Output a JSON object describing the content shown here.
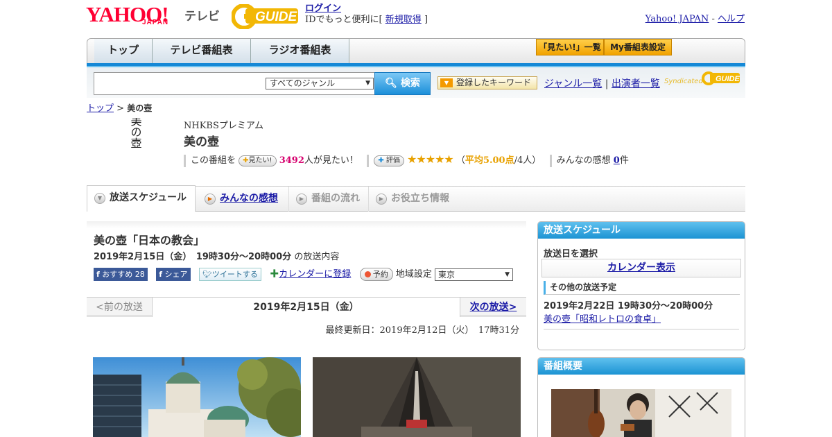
{
  "header": {
    "logo_yahoo": "YAHOO!",
    "logo_japan": "JAPAN",
    "logo_tv": "テレビ",
    "logo_gguide": "GUIDE",
    "login": "ログイン",
    "login_sub_prefix": "IDでもっと便利に[",
    "signup": "新規取得",
    "login_sub_suffix": "]",
    "yahoo_japan_link": "Yahoo! JAPAN",
    "sep": "-",
    "help_link": "ヘルプ"
  },
  "nav": {
    "tabs": [
      "トップ",
      "テレビ番組表",
      "ラジオ番組表"
    ],
    "watchlist_btn": "「見たい!」一覧",
    "my_schedule_btn": "My番組表設定"
  },
  "search": {
    "input_value": "",
    "genre_selected": "すべてのジャンル",
    "search_btn": "検索",
    "keyword_btn": "登録したキーワード",
    "genre_list": "ジャンル一覧",
    "divider": "|",
    "performer_list": "出演者一覧",
    "syndicated": "Syndicated",
    "gguide_small": "GUIDE"
  },
  "breadcrumb": {
    "top": "トップ",
    "sep": ">",
    "current": "美の壺"
  },
  "program": {
    "thumb_text": "美の壺",
    "channel": "NHKBSプレミアム",
    "title": "美の壺",
    "want_prefix": "この番組を",
    "want_btn": "見たい!",
    "want_count": "3492",
    "want_suffix": "人が見たい！",
    "rate_btn": "評価",
    "stars": "★★★★★",
    "avg_open": "（",
    "avg_label": "平均5.00点",
    "avg_count": "/4人）",
    "impressions_label": "みんなの感想",
    "impressions_count": "0",
    "impressions_unit": "件"
  },
  "tabs": [
    {
      "label": "放送スケジュール",
      "state": "active"
    },
    {
      "label": "みんなの感想",
      "state": "link"
    },
    {
      "label": "番組の流れ",
      "state": "disabled"
    },
    {
      "label": "お役立ち情報",
      "state": "disabled"
    }
  ],
  "episode": {
    "title": "美の壺「日本の教会」",
    "date": "2019年2月15日（金）　19時30分～20時00分",
    "date_suffix": "の放送内容",
    "fb_recommend": "おすすめ",
    "fb_count": "28",
    "fb_share": "シェア",
    "tweet": "ツイートする",
    "calendar": "カレンダーに登録",
    "reserve": "予約",
    "region_label": "地域設定",
    "region_value": "東京"
  },
  "pager": {
    "prev": "<前の放送",
    "current": "2019年2月15日（金）",
    "next": "次の放送>"
  },
  "updated": "最終更新日：2019年2月12日（火）　17時31分",
  "sidebar": {
    "schedule_header": "放送スケジュール",
    "select_date": "放送日を選択",
    "calendar_btn": "カレンダー表示",
    "other_header": "その他の放送予定",
    "other_date": "2019年2月22日  19時30分～20時00分",
    "other_title": "美の壺「昭和レトロの食卓」",
    "summary_header": "番組概要"
  },
  "colors": {
    "accent_blue": "#1588d6",
    "brand_red": "#ff0033",
    "gguide_yellow": "#f2b705",
    "star_orange": "#e8a100",
    "want_count_pink": "#d6006e"
  }
}
